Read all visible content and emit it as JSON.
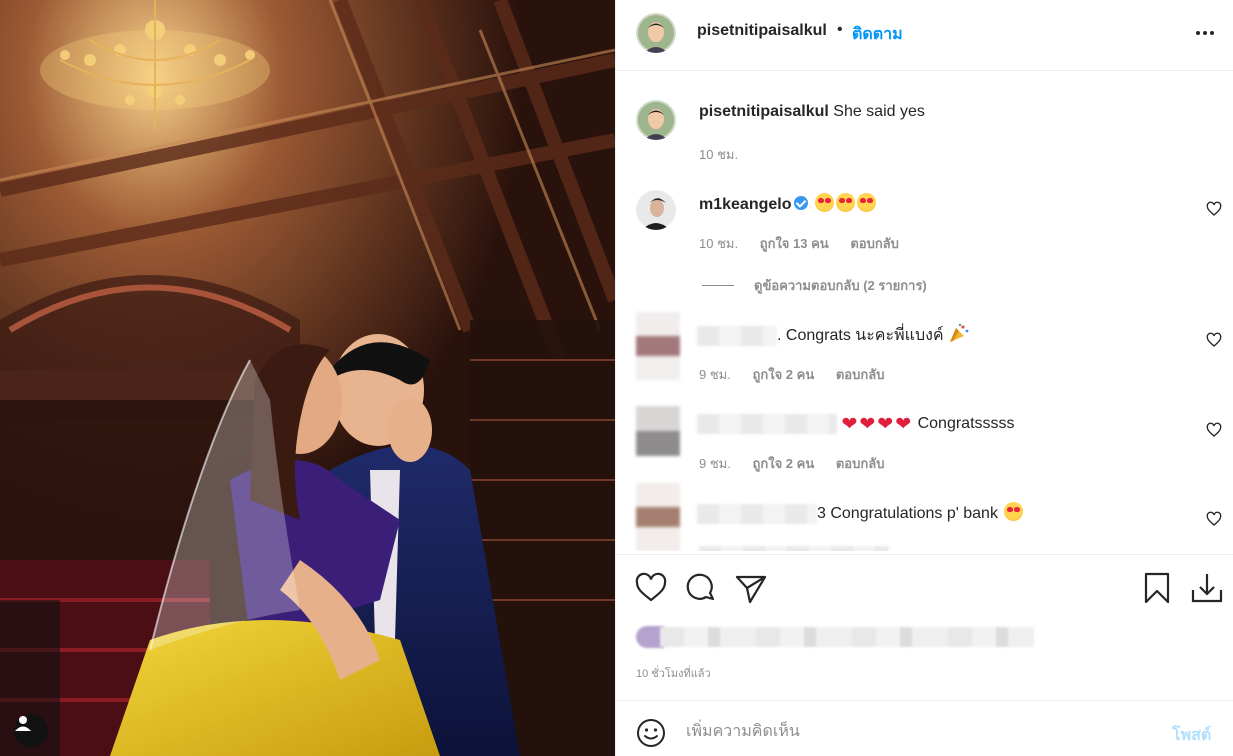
{
  "post": {
    "username": "pisetnitipaisalkul",
    "separator": "•",
    "follow_label": "ติดตาม"
  },
  "caption": {
    "username": "pisetnitipaisalkul",
    "text": "She said yes",
    "time": "10 ชม."
  },
  "comments": [
    {
      "username": "m1keangelo",
      "verified": true,
      "text_emoji": [
        "smiling-heart-eyes",
        "smiling-heart-eyes",
        "smiling-heart-eyes"
      ],
      "time": "10 ชม.",
      "likes": "ถูกใจ 13 คน",
      "reply": "ตอบกลับ"
    },
    {
      "username_blurred": true,
      "text": ". Congrats นะคะพี่แบงค์",
      "trailing_icon": "party-popper",
      "time": "9 ชม.",
      "likes": "ถูกใจ 2 คน",
      "reply": "ตอบกลับ"
    },
    {
      "username_blurred": true,
      "text": "Congratsssss",
      "leading_emoji": [
        "red-heart",
        "red-heart",
        "red-heart",
        "red-heart"
      ],
      "time": "9 ชม.",
      "likes": "ถูกใจ 2 คน",
      "reply": "ตอบกลับ"
    },
    {
      "username_blurred": true,
      "text": "3 Congratulations p' bank",
      "trailing_emoji": "smiling-heart-eyes"
    }
  ],
  "view_replies": "ดูข้อความตอบกลับ (2 รายการ)",
  "timestamp": "10 ชั่วโมงที่แล้ว",
  "add_comment": {
    "placeholder": "เพิ่มความคิดเห็น",
    "post_label": "โพสต์"
  },
  "colors": {
    "accent": "#0095f6",
    "muted": "#8e8e8e",
    "post_disabled": "#b2dffc",
    "heart_red": "#e01f3d"
  }
}
